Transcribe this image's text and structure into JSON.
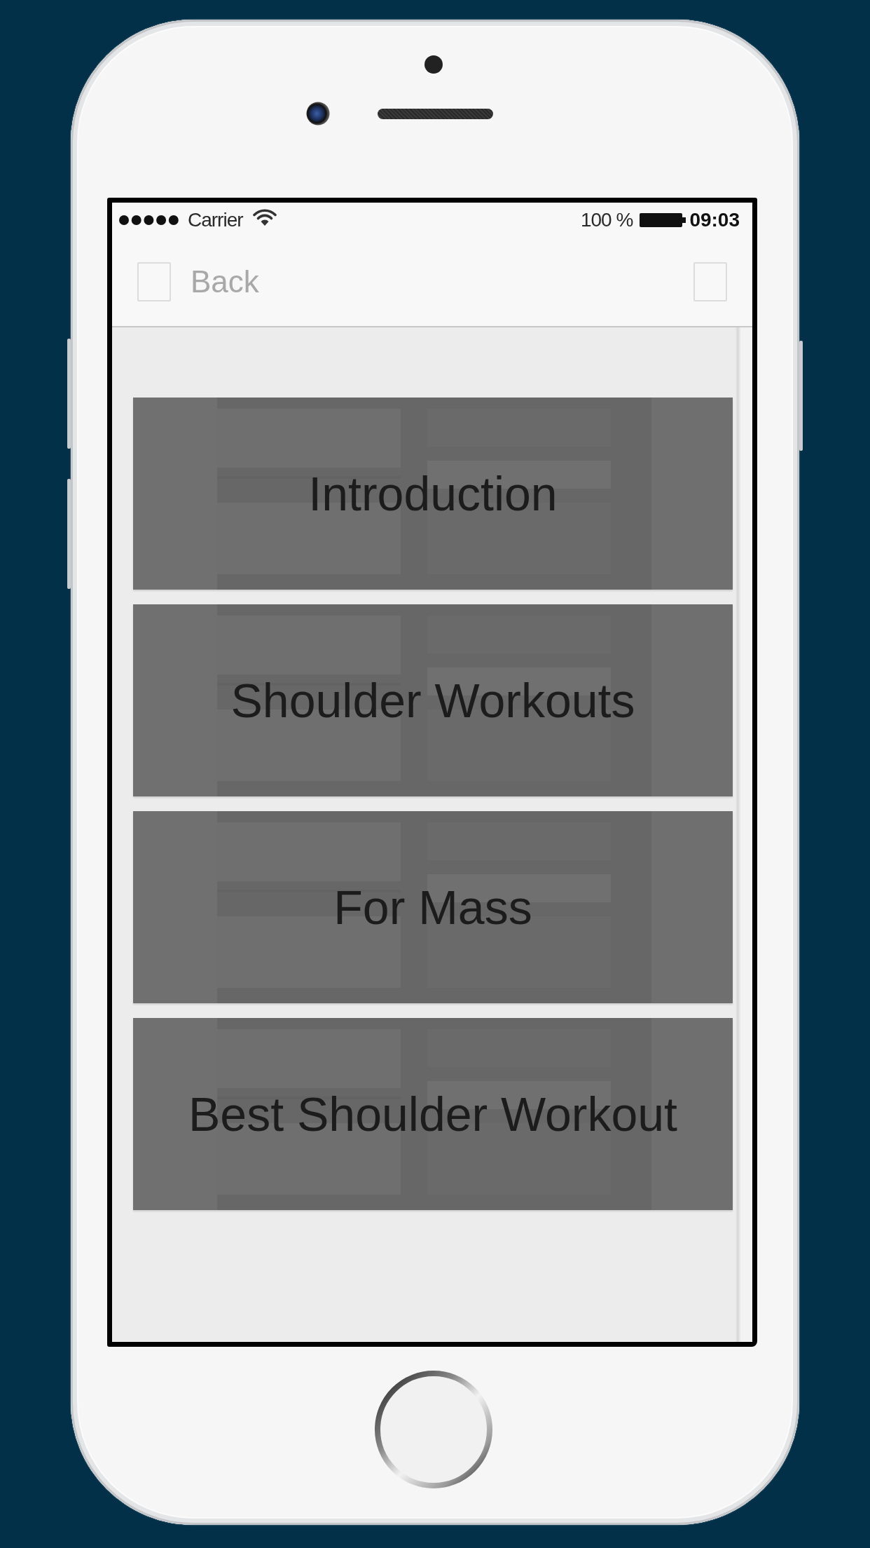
{
  "status_bar": {
    "carrier": "Carrier",
    "battery": "100 %",
    "time": "09:03"
  },
  "nav_bar": {
    "back_label": "Back"
  },
  "menu": [
    {
      "title": "Introduction"
    },
    {
      "title": "Shoulder Workouts"
    },
    {
      "title": "For Mass"
    },
    {
      "title": "Best Shoulder Workout"
    }
  ]
}
